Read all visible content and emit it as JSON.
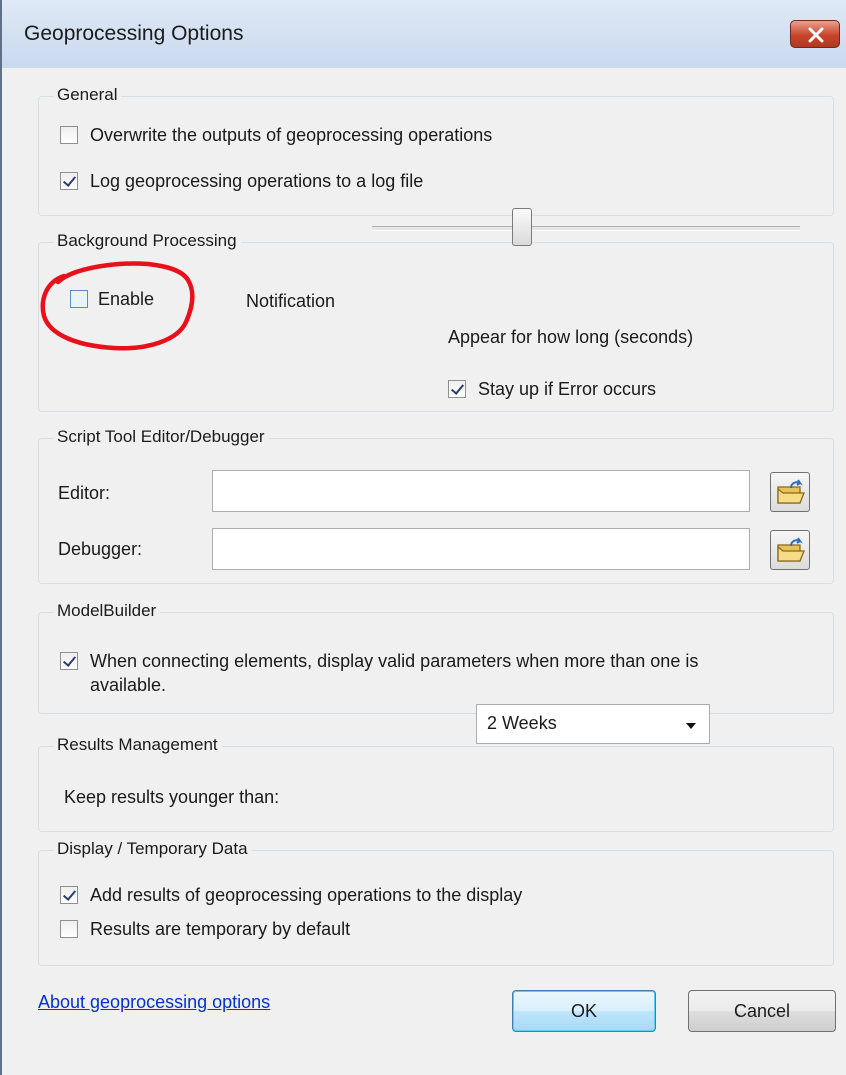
{
  "window": {
    "title": "Geoprocessing Options"
  },
  "general": {
    "legend": "General",
    "overwrite": {
      "label": "Overwrite the outputs of geoprocessing operations",
      "checked": false
    },
    "log": {
      "label": "Log geoprocessing operations to a log file",
      "checked": true
    }
  },
  "background": {
    "legend": "Background Processing",
    "enable": {
      "label": "Enable",
      "checked": false
    },
    "notification_label": "Notification",
    "slider_caption": "Appear for how long (seconds)",
    "stay_up": {
      "label": "Stay up if Error occurs",
      "checked": true
    }
  },
  "script": {
    "legend": "Script Tool Editor/Debugger",
    "editor_label": "Editor:",
    "editor_value": "",
    "debugger_label": "Debugger:",
    "debugger_value": ""
  },
  "modelbuilder": {
    "legend": "ModelBuilder",
    "valid_params": {
      "label_line1": "When connecting elements, display valid parameters when more than one is",
      "label_line2": "available.",
      "checked": true
    }
  },
  "results": {
    "legend": "Results Management",
    "keep_label": "Keep results younger than:",
    "keep_value": "2 Weeks"
  },
  "display": {
    "legend": "Display / Temporary Data",
    "add_results": {
      "label": "Add results of geoprocessing operations to the display",
      "checked": true
    },
    "temporary": {
      "label": "Results are temporary by default",
      "checked": false
    }
  },
  "footer": {
    "about_link": "About geoprocessing options",
    "ok_label": "OK",
    "cancel_label": "Cancel"
  },
  "colors": {
    "annotation": "#e8101a",
    "link": "#0033cc"
  }
}
